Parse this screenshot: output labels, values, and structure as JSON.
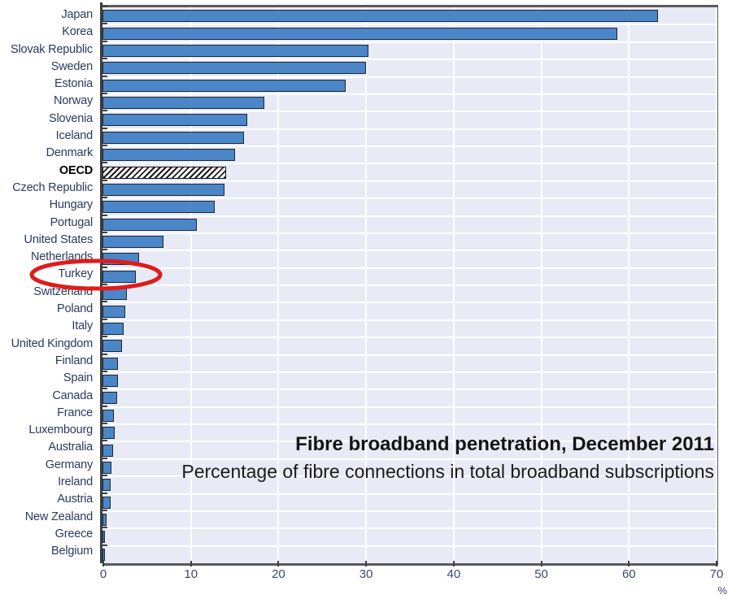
{
  "chart_data": {
    "type": "bar",
    "orientation": "horizontal",
    "title": "Fibre broadband penetration, December 2011",
    "subtitle": "Percentage of fibre connections in total broadband subscriptions",
    "xlabel": "%",
    "ylabel": "",
    "xlim": [
      0,
      70
    ],
    "xticks": [
      0,
      10,
      20,
      30,
      40,
      50,
      60,
      70
    ],
    "xtick_labels": [
      "0",
      "10",
      "20",
      "30",
      "40",
      "50",
      "60",
      "70"
    ],
    "grid": true,
    "legend": null,
    "unit": "%",
    "categories": [
      "Japan",
      "Korea",
      "Slovak Republic",
      "Sweden",
      "Estonia",
      "Norway",
      "Slovenia",
      "Iceland",
      "Denmark",
      "OECD",
      "Czech Republic",
      "Hungary",
      "Portugal",
      "United States",
      "Netherlands",
      "Turkey",
      "Switzerland",
      "Poland",
      "Italy",
      "United Kingdom",
      "Finland",
      "Spain",
      "Canada",
      "France",
      "Luxembourg",
      "Australia",
      "Germany",
      "Ireland",
      "Austria",
      "New Zealand",
      "Greece",
      "Belgium"
    ],
    "values": [
      63.4,
      58.8,
      30.4,
      30.1,
      27.8,
      18.5,
      16.5,
      16.2,
      15.1,
      14.1,
      13.9,
      12.8,
      10.8,
      7.0,
      4.2,
      3.8,
      2.8,
      2.6,
      2.4,
      2.2,
      1.8,
      1.8,
      1.7,
      1.3,
      1.4,
      1.2,
      1.0,
      0.9,
      0.9,
      0.5,
      0.2,
      0.1
    ],
    "highlighted_category": "Turkey",
    "aggregate_category": "OECD",
    "colors": {
      "bar_fill": "#4a86c8",
      "bar_outline": "#1b2735",
      "oecd_pattern": "hatched-black-white",
      "plot_background": "#e8ebf5",
      "gridline": "#ffffff",
      "axis": "#3f3f3f",
      "label_text": "#2b3a5c",
      "highlight_ellipse": "#e01b1b"
    }
  },
  "annotations": {
    "highlight_shape": "ellipse",
    "highlight_target_label": "Turkey"
  }
}
